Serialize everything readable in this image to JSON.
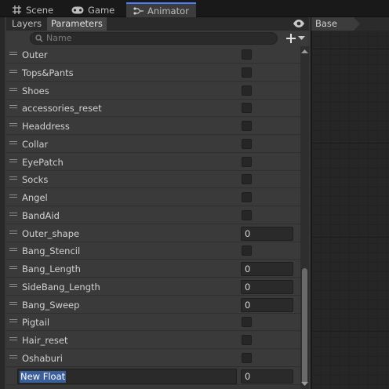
{
  "tabs": [
    {
      "label": "Scene",
      "icon": "grid-icon"
    },
    {
      "label": "Game",
      "icon": "gamepad-icon"
    },
    {
      "label": "Animator",
      "icon": "animator-icon",
      "active": true
    }
  ],
  "subtabs": {
    "layers": "Layers",
    "parameters": "Parameters"
  },
  "search": {
    "placeholder": "Name"
  },
  "breadcrumb": {
    "base": "Base"
  },
  "parameters": [
    {
      "name": "Outer",
      "type": "bool"
    },
    {
      "name": "Tops&Pants",
      "type": "bool"
    },
    {
      "name": "Shoes",
      "type": "bool"
    },
    {
      "name": "accessories_reset",
      "type": "bool"
    },
    {
      "name": "Headdress",
      "type": "bool"
    },
    {
      "name": "Collar",
      "type": "bool"
    },
    {
      "name": "EyePatch",
      "type": "bool"
    },
    {
      "name": "Socks",
      "type": "bool"
    },
    {
      "name": "Angel",
      "type": "bool"
    },
    {
      "name": "BandAid",
      "type": "bool"
    },
    {
      "name": "Outer_shape",
      "type": "float",
      "value": "0"
    },
    {
      "name": "Bang_Stencil",
      "type": "bool"
    },
    {
      "name": "Bang_Length",
      "type": "float",
      "value": "0"
    },
    {
      "name": "SideBang_Length",
      "type": "float",
      "value": "0"
    },
    {
      "name": "Bang_Sweep",
      "type": "float",
      "value": "0"
    },
    {
      "name": "Pigtail",
      "type": "bool"
    },
    {
      "name": "Hair_reset",
      "type": "bool"
    },
    {
      "name": "Oshaburi",
      "type": "bool"
    }
  ],
  "new_param": {
    "name": "New Float",
    "value": "0"
  },
  "colors": {
    "accent": "#4c7eff",
    "selection": "#3a5f9a",
    "panel": "#383838"
  }
}
